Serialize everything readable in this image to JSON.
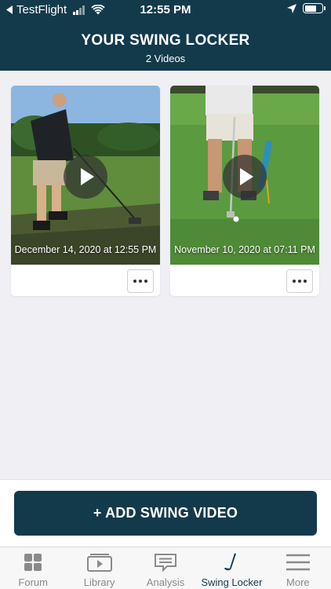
{
  "status_bar": {
    "back_app": "TestFlight",
    "time": "12:55 PM"
  },
  "header": {
    "title": "YOUR SWING LOCKER",
    "subtitle": "2 Videos"
  },
  "videos": [
    {
      "date": "December 14, 2020 at 12:55 PM"
    },
    {
      "date": "November 10, 2020 at 07:11 PM"
    }
  ],
  "add_button": {
    "label": "+ ADD SWING VIDEO"
  },
  "tabs": [
    {
      "label": "Forum",
      "icon": "grid-icon"
    },
    {
      "label": "Library",
      "icon": "video-library-icon"
    },
    {
      "label": "Analysis",
      "icon": "chat-bubble-icon"
    },
    {
      "label": "Swing Locker",
      "icon": "golf-club-icon",
      "active": true
    },
    {
      "label": "More",
      "icon": "menu-icon"
    }
  ],
  "colors": {
    "brand": "#133a4b",
    "background": "#efeff4",
    "tab_inactive": "#8a8a8a"
  }
}
